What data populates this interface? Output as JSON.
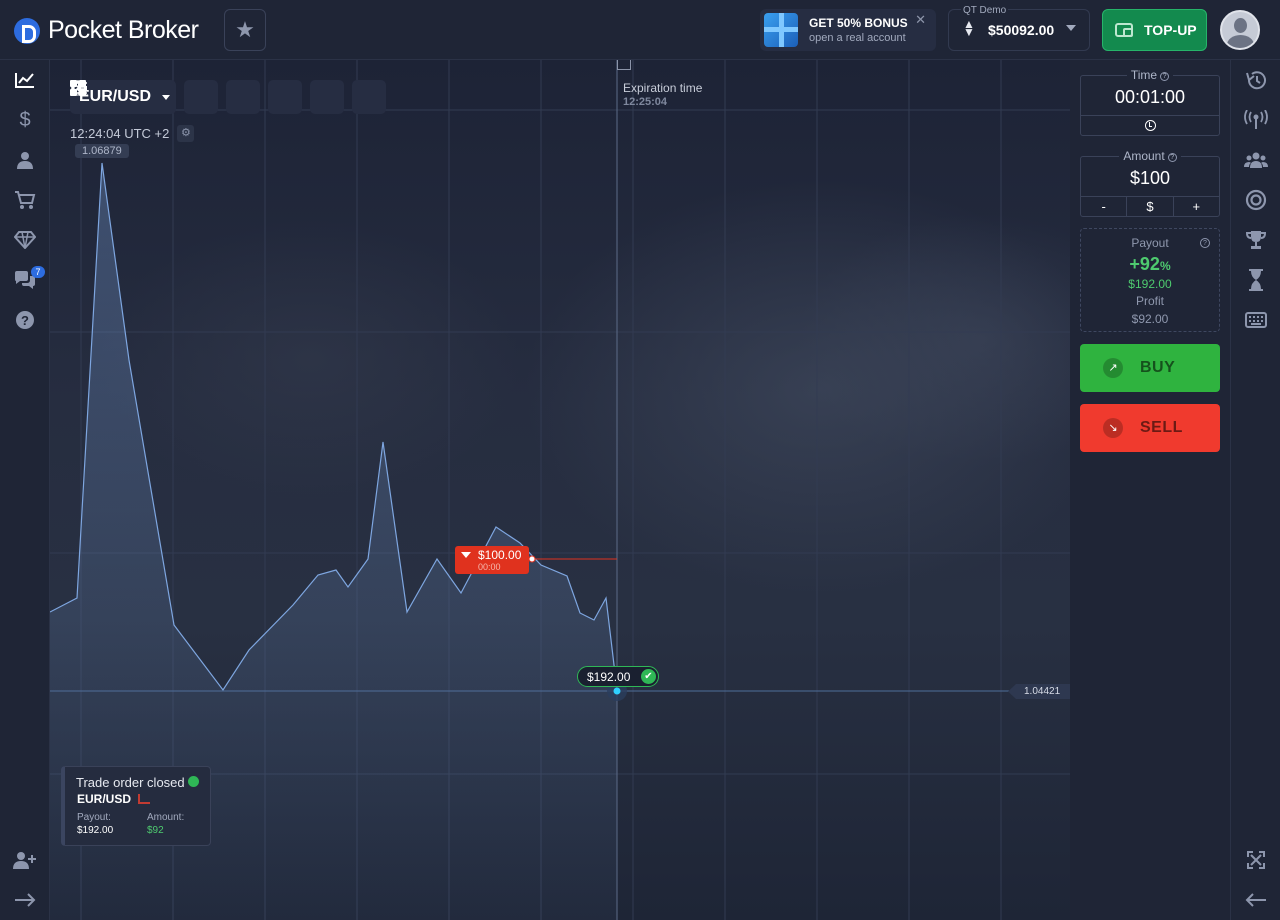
{
  "header": {
    "brand": "Pocket Broker",
    "bonus_title": "GET 50% BONUS",
    "bonus_subtitle": "open a real account",
    "bonus_close": "✕",
    "account_label": "QT Demo",
    "account_balance": "$50092.00",
    "topup_label": "TOP-UP"
  },
  "left_nav": {
    "chat_badge": "7"
  },
  "chart": {
    "pair": "EUR/USD",
    "server_time": "12:24:04 UTC +2",
    "max_price": "1.06879",
    "expiration_label": "Expiration time",
    "expiration_time": "12:25:04",
    "current_price": "1.04421",
    "order_amount": "$100.00",
    "order_timer": "00:00",
    "result_amount": "$192.00",
    "colors": {
      "line": "#7ea6e0",
      "order": "#e0321e",
      "win": "#2fb756"
    }
  },
  "toast": {
    "title": "Trade order closed",
    "pair": "EUR/USD",
    "payout_label": "Payout:",
    "payout_value": "$192.00",
    "amount_label": "Amount:",
    "amount_value": "$92"
  },
  "panel": {
    "time_label": "Time",
    "time_value": "00:01:00",
    "amount_label": "Amount",
    "amount_value": "$100",
    "amount_minus": "-",
    "amount_currency": "$",
    "amount_plus": "+",
    "payout_label": "Payout",
    "payout_percent": "+92",
    "payout_percent_sign": "%",
    "payout_total": "$192.00",
    "profit_label": "Profit",
    "profit_value": "$92.00",
    "buy_label": "BUY",
    "sell_label": "SELL"
  }
}
